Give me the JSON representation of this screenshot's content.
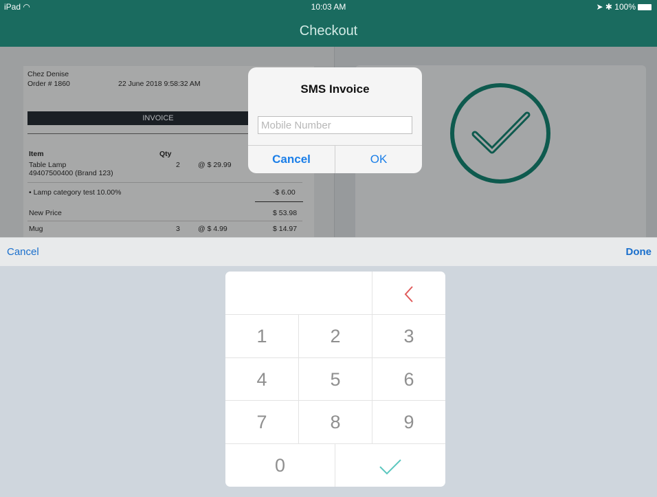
{
  "status_bar": {
    "device": "iPad",
    "time": "10:03 AM",
    "battery": "100%"
  },
  "nav": {
    "title": "Checkout"
  },
  "invoice": {
    "store": "Chez Denise",
    "order": "Order # 1860",
    "date": "22 June 2018 9:58:32 AM",
    "header": "INVOICE",
    "col_item": "Item",
    "col_qty": "Qty",
    "items": [
      {
        "name": "Table Lamp",
        "sku": "49407500400 (Brand 123)",
        "qty": "2",
        "price": "@ $ 29.99"
      },
      {
        "name": "Mug",
        "sku": "",
        "qty": "3",
        "price": "@ $ 4.99",
        "total": "$ 14.97"
      }
    ],
    "discount_label": "• Lamp category test 10.00%",
    "discount_value": "-$ 6.00",
    "new_price_label": "New Price",
    "new_price_value": "$ 53.98"
  },
  "sms_dialog": {
    "title": "SMS Invoice",
    "placeholder": "Mobile Number",
    "value": "",
    "cancel": "Cancel",
    "ok": "OK"
  },
  "keyboard_toolbar": {
    "cancel": "Cancel",
    "done": "Done"
  },
  "keypad": {
    "keys": [
      "1",
      "2",
      "3",
      "4",
      "5",
      "6",
      "7",
      "8",
      "9",
      "0"
    ],
    "backspace_icon": "chevron-left-icon",
    "confirm_icon": "checkmark-icon"
  },
  "colors": {
    "nav": "#1a6b5f",
    "link": "#1a7ee8",
    "backspace": "#e05a5a",
    "confirm": "#5cc7bf"
  }
}
